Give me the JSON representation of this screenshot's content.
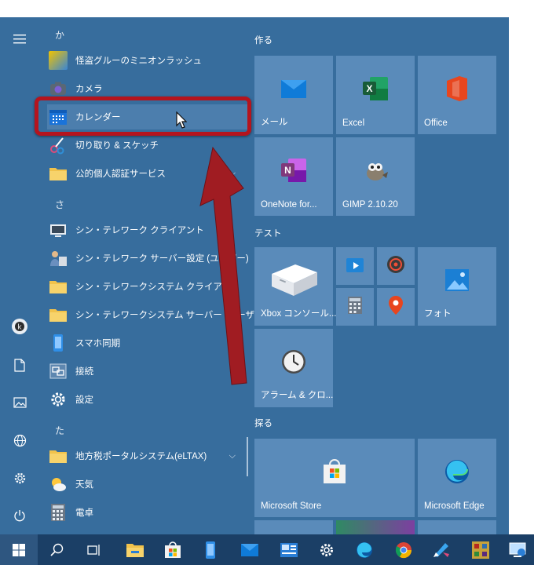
{
  "rail": {
    "icons": [
      "hamburger-icon",
      "user-icon",
      "document-icon",
      "pictures-icon",
      "globe-icon",
      "gear-icon",
      "power-icon"
    ]
  },
  "applist": {
    "sections": [
      {
        "letter": "か"
      },
      {
        "letter": "さ"
      },
      {
        "letter": "た"
      }
    ],
    "apps": [
      {
        "label": "怪盗グルーのミニオンラッシュ"
      },
      {
        "label": "カメラ"
      },
      {
        "label": "カレンダー"
      },
      {
        "label": "切り取り & スケッチ"
      },
      {
        "label": "公的個人認証サービス"
      },
      {
        "label": "シン・テレワーク クライアント"
      },
      {
        "label": "シン・テレワーク サーバー設定 (ユーザー)"
      },
      {
        "label": "シン・テレワークシステム クライアント"
      },
      {
        "label": "シン・テレワークシステム サーバー (ユーザー)"
      },
      {
        "label": "スマホ同期"
      },
      {
        "label": "接続"
      },
      {
        "label": "設定"
      },
      {
        "label": "地方税ポータルシステム(eLTAX)"
      },
      {
        "label": "天気"
      },
      {
        "label": "電卓"
      }
    ]
  },
  "tiles": {
    "groups": [
      "作る",
      "テスト",
      "探る"
    ],
    "items": [
      {
        "label": "メール"
      },
      {
        "label": "Excel"
      },
      {
        "label": "Office"
      },
      {
        "label": "OneNote for..."
      },
      {
        "label": "GIMP 2.10.20"
      },
      {
        "label": "Xbox コンソール..."
      },
      {
        "label": "フォト"
      },
      {
        "label": "アラーム & クロ..."
      },
      {
        "label": "Microsoft Store"
      },
      {
        "label": "Microsoft Edge"
      }
    ]
  },
  "taskbar": {
    "icons": [
      "windows-start-icon",
      "search-icon",
      "task-view-icon",
      "file-explorer-icon",
      "store-icon",
      "phone-icon",
      "mail-icon",
      "contacts-icon",
      "settings-icon",
      "edge-icon",
      "chrome-icon",
      "snip-icon",
      "game-icon",
      "remote-icon"
    ]
  },
  "colors": {
    "start_background": "#376d9d",
    "tile_background": "#5a8bba",
    "taskbar_background": "#1b3f66",
    "highlight_border": "#b4141e"
  }
}
